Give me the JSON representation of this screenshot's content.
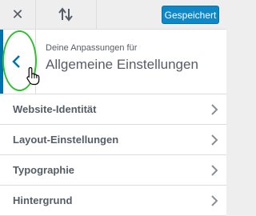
{
  "toolbar": {
    "close_icon": "close-icon",
    "sort_icon": "reorder-arrows-icon",
    "save_label": "Gespeichert",
    "save_color": "#0e88c6"
  },
  "panel": {
    "back_icon": "chevron-left-icon",
    "subtitle": "Deine Anpassungen für",
    "title": "Allgemeine Einstellungen",
    "accent_color": "#0073aa"
  },
  "menu": {
    "items": [
      {
        "label": "Website-Identität",
        "icon": "chevron-right-icon"
      },
      {
        "label": "Layout-Einstellungen",
        "icon": "chevron-right-icon"
      },
      {
        "label": "Typographie",
        "icon": "chevron-right-icon"
      },
      {
        "label": "Hintergrund",
        "icon": "chevron-right-icon"
      }
    ]
  }
}
